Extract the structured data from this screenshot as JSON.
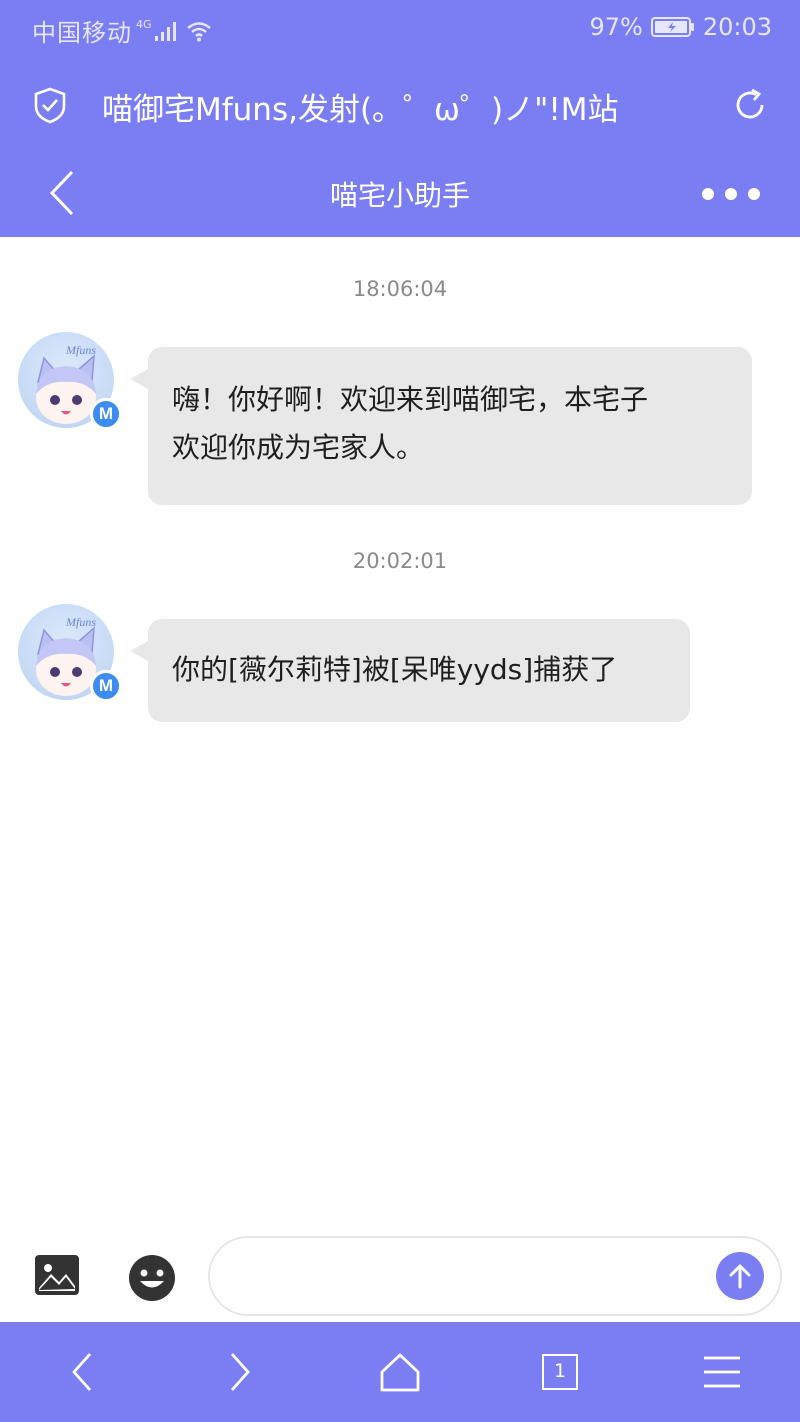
{
  "status_bar": {
    "carrier": "中国移动",
    "network": "4G",
    "battery": "97%",
    "time": "20:03"
  },
  "browser": {
    "site_title": "喵御宅Mfuns,发射(。゜ω゜)ノ\"!M站",
    "tab_count": "1"
  },
  "chat": {
    "title": "喵宅小助手",
    "avatar_badge": "M",
    "messages": [
      {
        "time": "18:06:04",
        "lines": [
          "嗨！你好啊！欢迎来到喵御宅，本宅子",
          "欢迎你成为宅家人。"
        ]
      },
      {
        "time": "20:02:01",
        "lines": [
          "你的[薇尔莉特]被[呆唯yyds]捕获了"
        ]
      }
    ]
  },
  "composer": {
    "placeholder": ""
  },
  "colors": {
    "accent": "#7b7ef3",
    "bubble": "#e8e8e8",
    "badge": "#3d8cf0"
  },
  "icons": [
    "shield-icon",
    "refresh-icon",
    "back-icon",
    "more-icon",
    "image-icon",
    "emoji-icon",
    "send-arrow-icon",
    "browser-back-icon",
    "browser-forward-icon",
    "home-icon",
    "tabs-icon",
    "menu-icon"
  ]
}
